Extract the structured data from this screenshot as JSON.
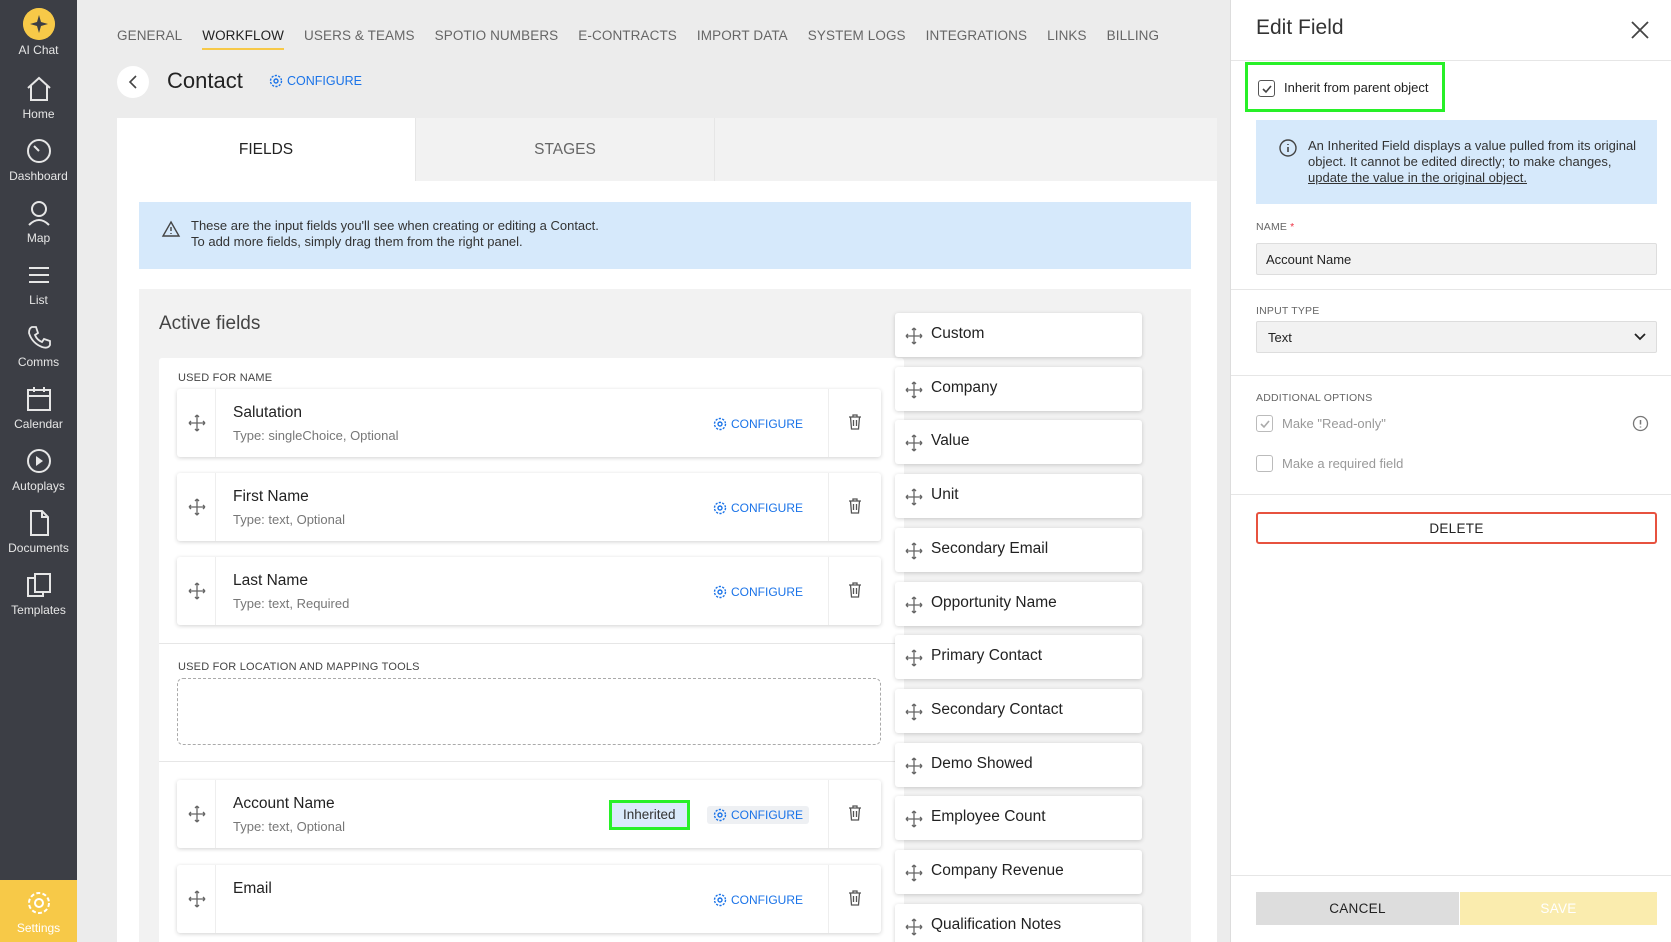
{
  "sidebar": {
    "items": [
      {
        "label": "AI Chat",
        "icon": "sparkle-icon"
      },
      {
        "label": "Home",
        "icon": "home-icon"
      },
      {
        "label": "Dashboard",
        "icon": "gauge-icon"
      },
      {
        "label": "Map",
        "icon": "map-pin-icon"
      },
      {
        "label": "List",
        "icon": "list-icon"
      },
      {
        "label": "Comms",
        "icon": "phone-icon"
      },
      {
        "label": "Calendar",
        "icon": "calendar-icon"
      },
      {
        "label": "Autoplays",
        "icon": "play-icon"
      },
      {
        "label": "Documents",
        "icon": "document-icon"
      },
      {
        "label": "Templates",
        "icon": "templates-icon"
      },
      {
        "label": "Settings",
        "icon": "gear-icon"
      }
    ],
    "accent": "#f7c948"
  },
  "top_nav": {
    "tabs": [
      "GENERAL",
      "WORKFLOW",
      "USERS & TEAMS",
      "SPOTIO NUMBERS",
      "E-CONTRACTS",
      "IMPORT DATA",
      "SYSTEM LOGS",
      "INTEGRATIONS",
      "LINKS",
      "BILLING"
    ],
    "active": "WORKFLOW"
  },
  "header": {
    "title": "Contact",
    "configure_label": "CONFIGURE"
  },
  "card_tabs": [
    "FIELDS",
    "STAGES"
  ],
  "banner": {
    "line1": "These are the input fields you'll see when creating or editing a Contact.",
    "line2": "To add more fields, simply drag them from the right panel."
  },
  "active_fields": {
    "title": "Active fields",
    "group_name_label": "USED FOR NAME",
    "group_location_label": "USED FOR LOCATION AND MAPPING TOOLS",
    "configure_label": "CONFIGURE",
    "inherited_label": "Inherited",
    "fields": [
      {
        "name": "Salutation",
        "type": "Type: singleChoice, Optional"
      },
      {
        "name": "First Name",
        "type": "Type: text, Optional"
      },
      {
        "name": "Last Name",
        "type": "Type: text, Required"
      },
      {
        "name": "Account Name",
        "type": "Type: text, Optional"
      },
      {
        "name": "Email",
        "type": ""
      }
    ]
  },
  "available_fields": [
    "Custom",
    "Company",
    "Value",
    "Unit",
    "Secondary Email",
    "Opportunity Name",
    "Primary Contact",
    "Secondary Contact",
    "Demo Showed",
    "Employee Count",
    "Company Revenue",
    "Qualification Notes"
  ],
  "edit_panel": {
    "title": "Edit Field",
    "inherit_label": "Inherit from parent object",
    "inherit_checked": true,
    "info_text": "An Inherited Field displays a value pulled from its original object. It cannot be edited directly; to make changes,",
    "info_link": "update the value in the original object.",
    "name_label": "NAME",
    "name_value": "Account Name",
    "input_type_label": "INPUT TYPE",
    "input_type_value": "Text",
    "additional_label": "ADDITIONAL OPTIONS",
    "read_only_label": "Make \"Read-only\"",
    "read_only_checked": true,
    "required_label": "Make a required field",
    "required_checked": false,
    "delete_label": "DELETE",
    "cancel_label": "CANCEL",
    "save_label": "SAVE"
  },
  "colors": {
    "accent": "#f7c948",
    "link": "#1a73e8",
    "highlight": "#28f028",
    "danger": "#e7523f",
    "banner": "#d6e9fb"
  }
}
